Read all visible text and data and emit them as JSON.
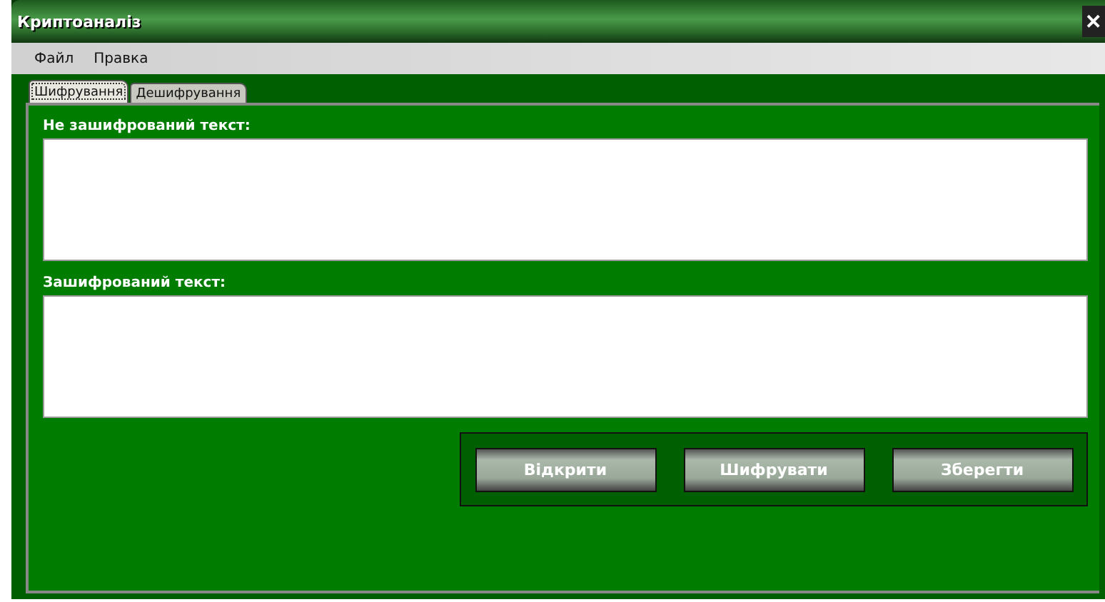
{
  "window": {
    "title": "Криптоаналіз",
    "close": "✕"
  },
  "menu": [
    "Файл",
    "Правка"
  ],
  "tabs": [
    {
      "label": "Шифрування",
      "selected": true
    },
    {
      "label": "Дешифрування",
      "selected": false
    }
  ],
  "fields": [
    {
      "label": "Не зашифрований текст:"
    },
    {
      "label": "Зашифрований текст:"
    }
  ],
  "buttons": [
    "Відкрити",
    "Шифрувати",
    "Зберегти"
  ]
}
